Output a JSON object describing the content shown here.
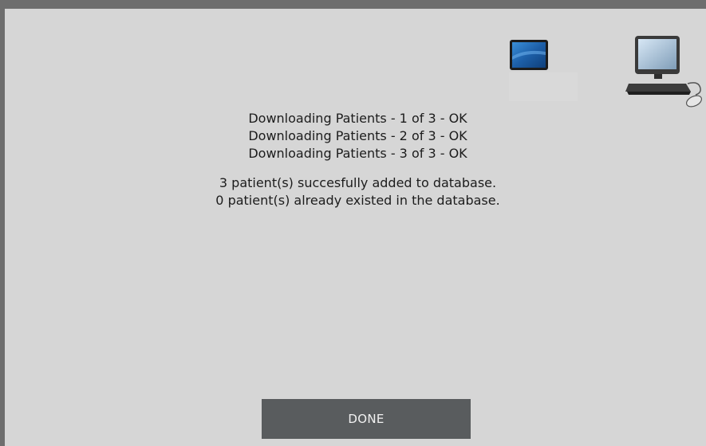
{
  "icons": {
    "tablet": "tablet-icon",
    "computer": "desktop-computer-icon"
  },
  "status": {
    "download_lines": [
      "Downloading Patients - 1 of 3 - OK",
      "Downloading Patients - 2 of 3 - OK",
      "Downloading Patients - 3 of 3 - OK"
    ],
    "summary_lines": [
      "3 patient(s) succesfully added to database.",
      "0 patient(s) already existed in the database."
    ]
  },
  "actions": {
    "done_label": "DONE"
  },
  "colors": {
    "background": "#d6d6d6",
    "frame": "#6e6e6e",
    "button": "#595c5e",
    "button_text": "#f1f1f1",
    "text": "#1c1c1c"
  }
}
